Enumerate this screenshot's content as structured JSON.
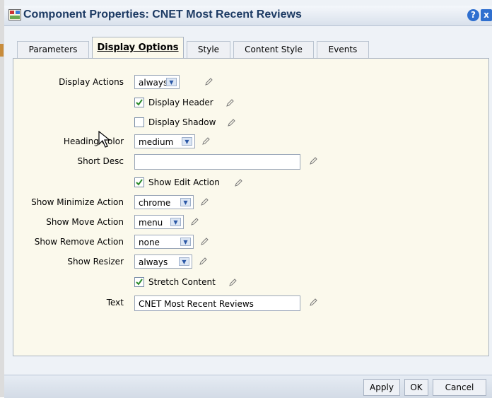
{
  "dialog": {
    "title": "Component Properties: CNET Most Recent Reviews",
    "help_label": "?",
    "close_label": "x"
  },
  "tabs": [
    {
      "label": "Parameters",
      "active": false
    },
    {
      "label": "Display Options",
      "active": true
    },
    {
      "label": "Style",
      "active": false
    },
    {
      "label": "Content Style",
      "active": false
    },
    {
      "label": "Events",
      "active": false
    }
  ],
  "form": {
    "display_actions": {
      "label": "Display Actions",
      "value": "always"
    },
    "display_header": {
      "label": "Display Header",
      "checked": true
    },
    "display_shadow": {
      "label": "Display Shadow",
      "checked": false
    },
    "heading_color": {
      "label": "Heading Color",
      "value": "medium"
    },
    "short_desc": {
      "label": "Short Desc",
      "value": ""
    },
    "show_edit_action": {
      "label": "Show Edit Action",
      "checked": true
    },
    "show_minimize_action": {
      "label": "Show Minimize Action",
      "value": "chrome"
    },
    "show_move_action": {
      "label": "Show Move Action",
      "value": "menu"
    },
    "show_remove_action": {
      "label": "Show Remove Action",
      "value": "none"
    },
    "show_resizer": {
      "label": "Show Resizer",
      "value": "always"
    },
    "stretch_content": {
      "label": "Stretch Content",
      "checked": true
    },
    "text": {
      "label": "Text",
      "value": "CNET Most Recent Reviews"
    }
  },
  "buttons": {
    "apply": "Apply",
    "ok": "OK",
    "cancel": "Cancel"
  },
  "icons": {
    "edit": "pencil-icon",
    "dropdown": "chevron-down-icon",
    "check": "checkmark-icon"
  },
  "colors": {
    "panel": "#fbf9ec",
    "title": "#1c3a63",
    "accent": "#2f6fcf"
  }
}
